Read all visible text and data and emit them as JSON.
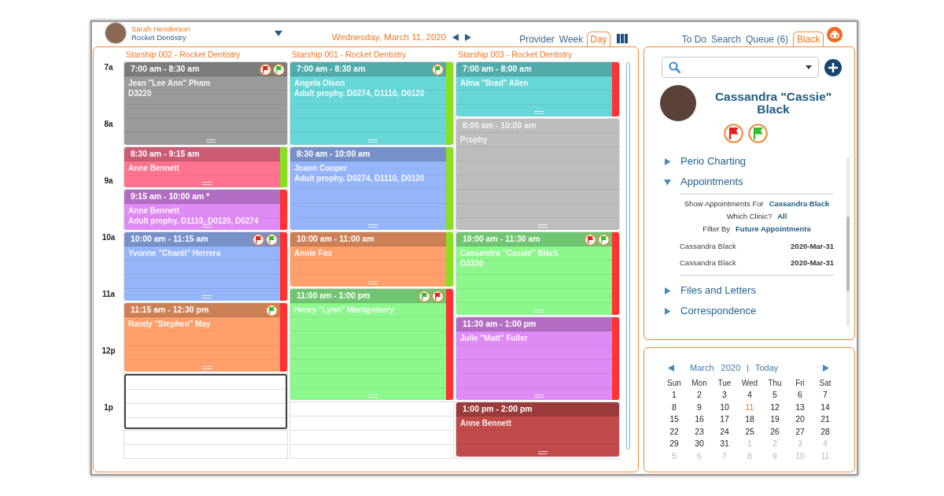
{
  "user": {
    "name": "Sarah Henderson",
    "practice": "Rocket Dentistry"
  },
  "date": "Wednesday, March 11, 2020",
  "view_tabs": [
    {
      "label": "Provider",
      "selected": false
    },
    {
      "label": "Week",
      "selected": false
    },
    {
      "label": "Day",
      "selected": true
    }
  ],
  "panel_tabs": [
    {
      "label": "To Do",
      "selected": false
    },
    {
      "label": "Search",
      "selected": false
    },
    {
      "label": "Queue (6)",
      "selected": false
    },
    {
      "label": "Black",
      "selected": true
    }
  ],
  "time_labels": [
    "7a",
    "8a",
    "9a",
    "10a",
    "11a",
    "12p",
    "1p"
  ],
  "columns": [
    {
      "title": "Starship 002 - Rocket Dentistry",
      "appointments": [
        {
          "kind": "appointment",
          "time": "7:00 am - 8:30 am",
          "lines": [
            "Jean \"Lee Ann\" Pham",
            "D3220"
          ],
          "color": "#9a9a9a",
          "flags": [
            {
              "color": "#dd2222"
            },
            {
              "color": "#33bb33"
            }
          ]
        },
        {
          "kind": "appointment",
          "time": "8:30 am - 9:15 am",
          "lines": [
            "Anne Bennett"
          ],
          "color": "#ff7391",
          "status_bar": {
            "color": "#88e021"
          }
        },
        {
          "kind": "appointment",
          "time": "9:15 am - 10:00 am *",
          "lines": [
            "Anne Bennett",
            "Adult prophy. D1110, D0120, D0274"
          ],
          "color": "#e08af5",
          "status_bar": {
            "color": "#ff3333"
          }
        },
        {
          "kind": "appointment",
          "time": "10:00 am - 11:15 am",
          "lines": [
            "Yvonne \"Chanti\" Herrera"
          ],
          "color": "#95b5fb",
          "status_bar": {
            "color": "#ff3333"
          },
          "flags": [
            {
              "color": "#dd2222"
            },
            {
              "color": "#33bb33"
            }
          ]
        },
        {
          "kind": "appointment",
          "time": "11:15 am - 12:30 pm",
          "lines": [
            "Randy \"Stephen\" May"
          ],
          "color": "#ffa06c",
          "status_bar": {
            "color": "#ff3333"
          },
          "flags": [
            {
              "color": "#33bb33"
            }
          ]
        },
        {
          "kind": "selection"
        }
      ]
    },
    {
      "title": "Starship 001 - Rocket Dentistry",
      "appointments": [
        {
          "kind": "appointment",
          "time": "7:00 am - 8:30 am",
          "lines": [
            "Angela Olson",
            "Adult prophy. D0274, D1110, D0120"
          ],
          "color": "#66d6d6",
          "status_bar": {
            "color": "#88e021"
          },
          "flags": [
            {
              "color": "#33bb33"
            }
          ]
        },
        {
          "kind": "appointment",
          "time": "8:30 am - 10:00 am",
          "lines": [
            "Joann Cooper",
            "Adult prophy. D0274, D1110, D0120"
          ],
          "color": "#95b5fb",
          "status_bar": {
            "color": "#88e021"
          }
        },
        {
          "kind": "appointment",
          "time": "10:00 am - 11:00 am",
          "lines": [
            "Annie Fox"
          ],
          "color": "#ffa06c",
          "status_bar": {
            "color": "#88e021"
          }
        },
        {
          "kind": "appointment",
          "time": "11:00 am - 1:00 pm",
          "lines": [
            "Henry \"Lynn\" Montgomery"
          ],
          "color": "#8cf78c",
          "status_bar": {
            "color": "#ff3333"
          },
          "flags": [
            {
              "color": "#33bb33"
            },
            {
              "color": "#dd2222"
            }
          ]
        }
      ]
    },
    {
      "title": "Starship 003 - Rocket Dentistry",
      "appointments": [
        {
          "kind": "appointment",
          "time": "7:00 am - 8:00 am",
          "lines": [
            "Alma \"Brad\" Allen"
          ],
          "color": "#66d6d6",
          "status_bar": {
            "color": "#ff3333"
          }
        },
        {
          "kind": "block",
          "time": "8:00 am - 10:00 am",
          "lines": [
            "Prophy"
          ],
          "color": "#bdbdbd"
        },
        {
          "kind": "appointment",
          "time": "10:00 am - 11:30 am",
          "lines": [
            "Cassandra \"Cassie\" Black",
            "D3330"
          ],
          "color": "#8cf78c",
          "status_bar": {
            "color": "#ff3333"
          },
          "flags": [
            {
              "color": "#dd2222"
            },
            {
              "color": "#33bb33"
            }
          ]
        },
        {
          "kind": "appointment",
          "time": "11:30 am - 1:00 pm",
          "lines": [
            "Julie \"Matt\" Fuller"
          ],
          "color": "#e08af5",
          "status_bar": {
            "color": "#ff3333"
          }
        },
        {
          "kind": "appointment",
          "time": "1:00 pm - 2:00 pm",
          "lines": [
            "Anne Bennett"
          ],
          "color": "#c24a4a"
        }
      ]
    }
  ],
  "patient": {
    "name": "Cassandra \"Cassie\" Black",
    "flags": [
      {
        "color": "#dd2222"
      },
      {
        "color": "#33bb33"
      }
    ]
  },
  "sections": [
    {
      "label": "Perio Charting",
      "expanded": false
    },
    {
      "label": "Appointments",
      "expanded": true,
      "filters": [
        {
          "label": "Show Appointments For",
          "value": "Cassandra Black"
        },
        {
          "label": "Which Clinic?",
          "value": "All"
        },
        {
          "label": "Filter By",
          "value": "Future Appointments"
        }
      ],
      "rows": [
        {
          "name": "Cassandra Black",
          "date": "2020-Mar-31"
        },
        {
          "name": "Cassandra Black",
          "date": "2020-Mar-31"
        }
      ]
    },
    {
      "label": "Files and Letters",
      "expanded": false
    },
    {
      "label": "Correspondence",
      "expanded": false
    }
  ],
  "mini_calendar": {
    "month": "March",
    "year": "2020",
    "separator": "|",
    "today_link": "Today",
    "weekdays": [
      "Sun",
      "Mon",
      "Tue",
      "Wed",
      "Thu",
      "Fri",
      "Sat"
    ],
    "weeks": [
      [
        {
          "day": "1",
          "muted": false,
          "selected": false
        },
        {
          "day": "2",
          "muted": false,
          "selected": false
        },
        {
          "day": "3",
          "muted": false,
          "selected": false
        },
        {
          "day": "4",
          "muted": false,
          "selected": false
        },
        {
          "day": "5",
          "muted": false,
          "selected": false
        },
        {
          "day": "6",
          "muted": false,
          "selected": false
        },
        {
          "day": "7",
          "muted": false,
          "selected": false
        }
      ],
      [
        {
          "day": "8",
          "muted": false,
          "selected": false
        },
        {
          "day": "9",
          "muted": false,
          "selected": false
        },
        {
          "day": "10",
          "muted": false,
          "selected": false
        },
        {
          "day": "11",
          "muted": false,
          "selected": true
        },
        {
          "day": "12",
          "muted": false,
          "selected": false
        },
        {
          "day": "13",
          "muted": false,
          "selected": false
        },
        {
          "day": "14",
          "muted": false,
          "selected": false
        }
      ],
      [
        {
          "day": "15",
          "muted": false,
          "selected": false
        },
        {
          "day": "16",
          "muted": false,
          "selected": false
        },
        {
          "day": "17",
          "muted": false,
          "selected": false
        },
        {
          "day": "18",
          "muted": false,
          "selected": false
        },
        {
          "day": "19",
          "muted": false,
          "selected": false
        },
        {
          "day": "20",
          "muted": false,
          "selected": false
        },
        {
          "day": "21",
          "muted": false,
          "selected": false
        }
      ],
      [
        {
          "day": "22",
          "muted": false,
          "selected": false
        },
        {
          "day": "23",
          "muted": false,
          "selected": false
        },
        {
          "day": "24",
          "muted": false,
          "selected": false
        },
        {
          "day": "25",
          "muted": false,
          "selected": false
        },
        {
          "day": "26",
          "muted": false,
          "selected": false
        },
        {
          "day": "27",
          "muted": false,
          "selected": false
        },
        {
          "day": "28",
          "muted": false,
          "selected": false
        }
      ],
      [
        {
          "day": "29",
          "muted": false,
          "selected": false
        },
        {
          "day": "30",
          "muted": false,
          "selected": false
        },
        {
          "day": "31",
          "muted": false,
          "selected": false
        },
        {
          "day": "1",
          "muted": true,
          "selected": false
        },
        {
          "day": "2",
          "muted": true,
          "selected": false
        },
        {
          "day": "3",
          "muted": true,
          "selected": false
        },
        {
          "day": "4",
          "muted": true,
          "selected": false
        }
      ],
      [
        {
          "day": "5",
          "muted": true,
          "selected": false
        },
        {
          "day": "6",
          "muted": true,
          "selected": false
        },
        {
          "day": "7",
          "muted": true,
          "selected": false
        },
        {
          "day": "8",
          "muted": true,
          "selected": false
        },
        {
          "day": "9",
          "muted": true,
          "selected": false
        },
        {
          "day": "10",
          "muted": true,
          "selected": false
        },
        {
          "day": "11",
          "muted": true,
          "selected": false
        }
      ]
    ]
  }
}
